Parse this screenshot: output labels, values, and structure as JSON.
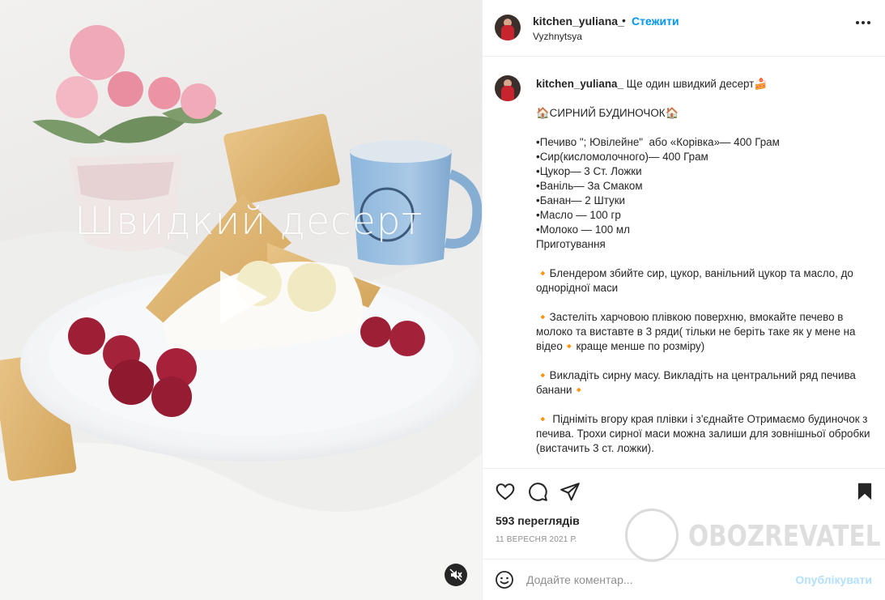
{
  "media": {
    "overlay_title": "Швидкий десерт"
  },
  "post": {
    "username": "kitchen_yuliana_",
    "separator": "•",
    "follow_label": "Стежити",
    "location": "Vyzhnytsya",
    "caption_lines": [
      "Ще один швидкий десерт🍰",
      "",
      "🏠СИРНИЙ БУДИНОЧОК🏠",
      "",
      "•Печиво \"; Ювілейне\"  або «Корівка»— 400 Грам",
      "•Сир(кисломолочного)— 400 Грам",
      "•Цукор— 3 Ст. Ложки",
      "•Ваніль— За Смаком",
      "•Банан— 2 Штуки",
      "•Масло — 100 гр",
      "•Молоко — 100 мл",
      "Приготування",
      "",
      "🔸Блендером збийте сир, цукор, ванільний цукор та масло, до однорідної маси",
      "",
      "🔸Застеліть харчовою плівкою поверхню, вмокайте печево в молоко та виставте в 3 ряди( тільки не беріть таке як у мене на відео🔸краще менше по розміру)",
      "",
      "🔸Викладіть сирну масу. Викладіть на центральний ряд печива банани🔸",
      "",
      "🔸 Підніміть вгору края плівки і з'єднайте Отримаємо будиночок з печива. Трохи сирної маси можна залиши для зовнішньої обробки (вистачить 3 ст. ложки)."
    ],
    "views": "593 переглядів",
    "date": "11 ВЕРЕСНЯ 2021 Р."
  },
  "comment": {
    "placeholder": "Додайте коментар...",
    "publish_label": "Опублікувати"
  },
  "watermark": {
    "text": "OBOZREVATEL"
  },
  "icons": {
    "like": "heart-icon",
    "comment": "comment-icon",
    "share": "share-icon",
    "save": "bookmark-icon",
    "emoji": "emoji-icon",
    "more": "more-icon",
    "play": "play-icon",
    "mute": "mute-icon"
  },
  "colors": {
    "link": "#0095f6",
    "publish_disabled": "#b2dffc",
    "muted_text": "#8e8e8e",
    "text": "#262626"
  }
}
